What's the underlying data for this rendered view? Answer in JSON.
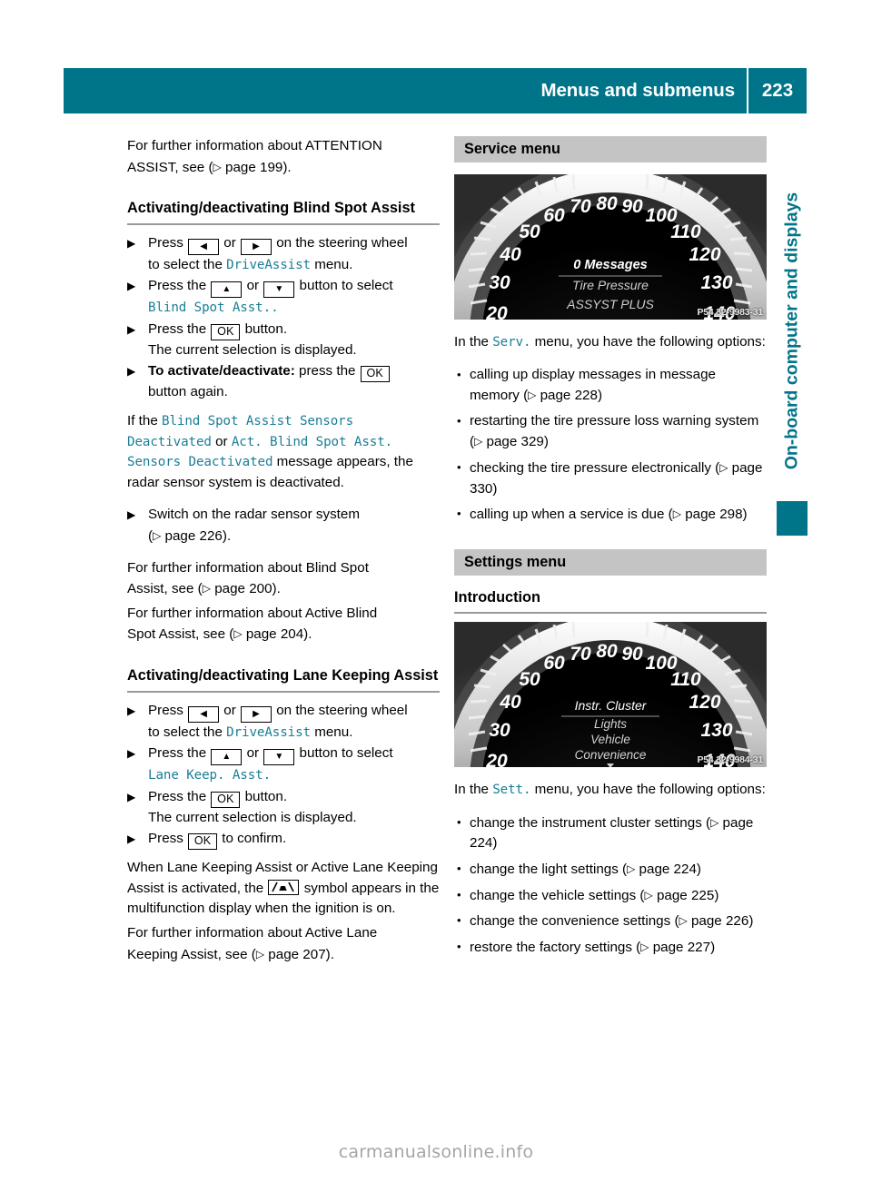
{
  "header": {
    "title": "Menus and submenus",
    "page_number": "223"
  },
  "side_tab": {
    "label": "On-board computer and displays",
    "accent_color": "#007489"
  },
  "left_column": {
    "intro": {
      "line1": "For further information about ATTENTION",
      "line2_pre": "ASSIST, see (",
      "line2_ref": "page 199",
      "line2_post": ")."
    },
    "section_blind_spot": {
      "heading": "Activating/deactivating Blind Spot Assist",
      "steps": [
        {
          "pre": "Press ",
          "key1": "◀",
          "mid": " or ",
          "key2": "▶",
          "post": " on the steering wheel",
          "cont_pre": "to select the ",
          "cont_mono": "DriveAssist",
          "cont_post": " menu."
        },
        {
          "pre": "Press the ",
          "key1": "▲",
          "mid": " or ",
          "key2": "▼",
          "post": " button to select",
          "cont_mono": "Blind Spot Asst.."
        },
        {
          "pre": "Press the ",
          "key1": "OK",
          "post": " button.",
          "sub": "The current selection is displayed."
        },
        {
          "bold_pre": "To activate/deactivate:",
          "pre": " press the ",
          "key1": "OK",
          "cont": "button again."
        }
      ],
      "note": {
        "p1": "If the ",
        "m1": "Blind Spot Assist Sensors Deactivated",
        "p2": " or ",
        "m2": "Act. Blind Spot Asst. Sensors Deactivated",
        "p3": " message appears, the radar sensor system is deactivated."
      },
      "switch_step": {
        "text": "Switch on the radar sensor system",
        "ref_pre": "(",
        "ref": "page 226",
        "ref_post": ")."
      },
      "further_1": {
        "line1": "For further information about Blind Spot",
        "line2_pre": "Assist, see (",
        "line2_ref": "page 200",
        "line2_post": ")."
      },
      "further_2": {
        "line1": "For further information about Active Blind",
        "line2_pre": "Spot Assist, see (",
        "line2_ref": "page 204",
        "line2_post": ")."
      }
    },
    "section_lane_keeping": {
      "heading": "Activating/deactivating Lane Keeping Assist",
      "steps": [
        {
          "pre": "Press ",
          "key1": "◀",
          "mid": " or ",
          "key2": "▶",
          "post": " on the steering wheel",
          "cont_pre": "to select the ",
          "cont_mono": "DriveAssist",
          "cont_post": " menu."
        },
        {
          "pre": "Press the ",
          "key1": "▲",
          "mid": " or ",
          "key2": "▼",
          "post": " button to select",
          "cont_mono": "Lane Keep. Asst."
        },
        {
          "pre": "Press the ",
          "key1": "OK",
          "post": " button.",
          "sub": "The current selection is displayed."
        },
        {
          "pre": "Press ",
          "key1": "OK",
          "post": " to confirm."
        }
      ],
      "note": {
        "p1": "When Lane Keeping Assist or Active Lane Keeping Assist is activated, the ",
        "p2": " symbol appears in the multifunction display when the ignition is on."
      },
      "further": {
        "line1": "For further information about Active Lane",
        "line2_pre": "Keeping Assist, see (",
        "line2_ref": "page 207",
        "line2_post": ")."
      }
    }
  },
  "right_column": {
    "service": {
      "band_title": "Service menu",
      "figure": {
        "code": "P54.32-9983-31",
        "display_lines": [
          "0 Messages",
          "Tire Pressure",
          "ASSYST PLUS"
        ],
        "speed_labels": [
          "20",
          "30",
          "40",
          "50",
          "60",
          "70",
          "80",
          "90",
          "100",
          "110",
          "120",
          "130",
          "140"
        ]
      },
      "intro_pre": "In the ",
      "intro_mono": "Serv.",
      "intro_post": " menu, you have the following options:",
      "options": [
        {
          "text": "calling up display messages in message memory (",
          "ref": "page 228",
          "post": ")"
        },
        {
          "text": "restarting the tire pressure loss warning system (",
          "ref": "page 329",
          "post": ")"
        },
        {
          "text": "checking the tire pressure electronically (",
          "ref": "page 330",
          "post": ")"
        },
        {
          "text": "calling up when a service is due (",
          "ref": "page 298",
          "post": ")"
        }
      ]
    },
    "settings": {
      "band_title": "Settings menu",
      "sub_heading": "Introduction",
      "figure": {
        "code": "P54.32-9984-31",
        "display_lines": [
          "Instr. Cluster",
          "Lights",
          "Vehicle",
          "Convenience"
        ],
        "speed_labels": [
          "20",
          "30",
          "40",
          "50",
          "60",
          "70",
          "80",
          "90",
          "100",
          "110",
          "120",
          "130",
          "140"
        ]
      },
      "intro_pre": "In the ",
      "intro_mono": "Sett.",
      "intro_post": " menu, you have the following options:",
      "options": [
        {
          "text": "change the instrument cluster settings (",
          "ref": "page 224",
          "post": ")"
        },
        {
          "text": "change the light settings (",
          "ref": "page 224",
          "post": ")"
        },
        {
          "text": "change the vehicle settings (",
          "ref": "page 225",
          "post": ")"
        },
        {
          "text": "change the convenience settings (",
          "ref": "page 226",
          "post": ")"
        },
        {
          "text": "restore the factory settings (",
          "ref": "page 227",
          "post": ")"
        }
      ]
    }
  },
  "watermark": "carmanualsonline.info"
}
